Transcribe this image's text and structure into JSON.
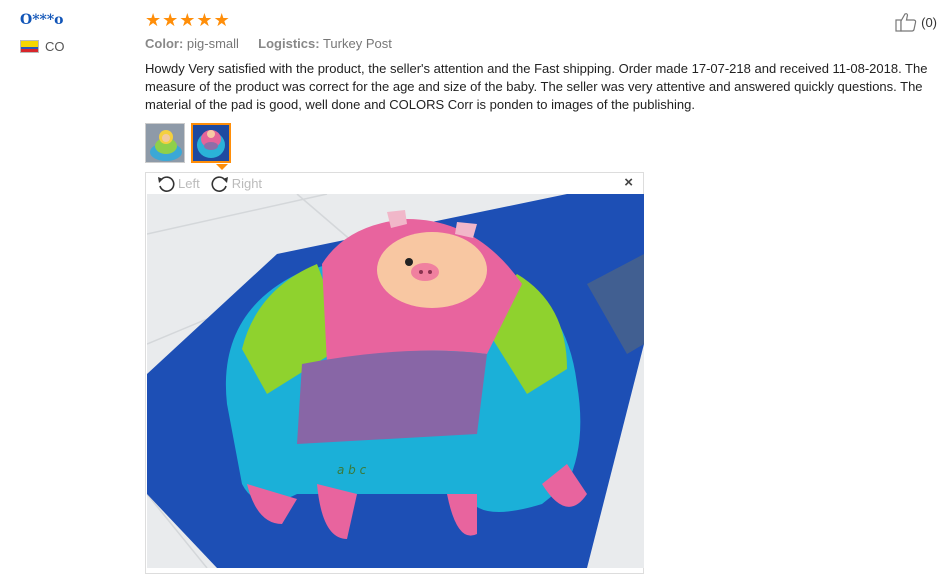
{
  "user": {
    "name": "O***o",
    "country": "CO"
  },
  "rating": {
    "stars": 5
  },
  "like": {
    "count": "(0)"
  },
  "meta": {
    "color_label": "Color:",
    "color_value": "pig-small",
    "logistics_label": "Logistics:",
    "logistics_value": "Turkey Post"
  },
  "review_text": "Howdy Very satisfied with the product, the seller's attention and the Fast shipping. Order made 17-07-218 and received 11-08-2018. The measure of the product was correct for the age and size of the baby. The seller was very attentive and answered quickly questions. The material of the pad is good, well done and COLORS Corr is ponden to images of the publishing.",
  "viewer": {
    "left_label": "Left",
    "right_label": "Right",
    "close_glyph": "×"
  },
  "colors": {
    "star": "#ff8e09",
    "username": "#1155b8",
    "active_thumb_border": "#ff8e09"
  },
  "icons": [
    "thumbs-up-icon",
    "rotate-left-icon",
    "rotate-right-icon",
    "close-icon",
    "flag-icon",
    "star-icon"
  ]
}
